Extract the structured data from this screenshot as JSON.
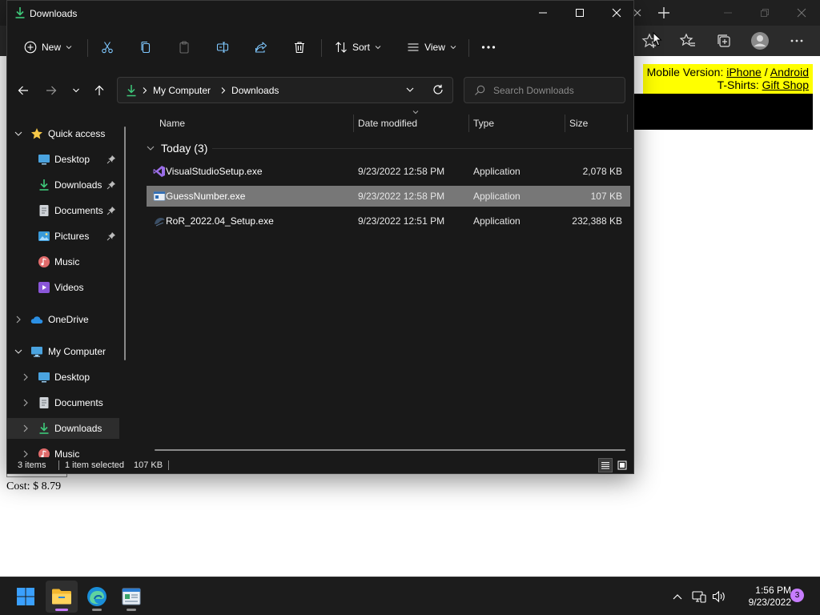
{
  "window": {
    "title": "Downloads"
  },
  "toolbar": {
    "new_label": "New",
    "sort_label": "Sort",
    "view_label": "View"
  },
  "address": {
    "segments": [
      "My Computer",
      "Downloads"
    ]
  },
  "search": {
    "placeholder": "Search Downloads"
  },
  "sidebar": {
    "items": [
      {
        "label": "Quick access",
        "icon": "star-icon"
      },
      {
        "label": "Desktop",
        "icon": "desktop-icon",
        "pinned": true
      },
      {
        "label": "Downloads",
        "icon": "download-icon",
        "pinned": true
      },
      {
        "label": "Documents",
        "icon": "documents-icon",
        "pinned": true
      },
      {
        "label": "Pictures",
        "icon": "pictures-icon",
        "pinned": true
      },
      {
        "label": "Music",
        "icon": "music-icon"
      },
      {
        "label": "Videos",
        "icon": "videos-icon"
      },
      {
        "label": "OneDrive",
        "icon": "cloud-icon"
      },
      {
        "label": "My Computer",
        "icon": "computer-icon"
      },
      {
        "label": "Desktop",
        "icon": "desktop-icon"
      },
      {
        "label": "Documents",
        "icon": "documents-icon"
      },
      {
        "label": "Downloads",
        "icon": "download-icon"
      },
      {
        "label": "Music",
        "icon": "music-icon"
      }
    ]
  },
  "columns": {
    "name": "Name",
    "date": "Date modified",
    "type": "Type",
    "size": "Size"
  },
  "group": {
    "label": "Today (3)"
  },
  "files": [
    {
      "name": "VisualStudioSetup.exe",
      "date": "9/23/2022 12:58 PM",
      "type": "Application",
      "size": "2,078 KB"
    },
    {
      "name": "GuessNumber.exe",
      "date": "9/23/2022 12:58 PM",
      "type": "Application",
      "size": "107 KB"
    },
    {
      "name": "RoR_2022.04_Setup.exe",
      "date": "9/23/2022 12:51 PM",
      "type": "Application",
      "size": "232,388 KB"
    }
  ],
  "status": {
    "items": "3 items",
    "selected": "1 item selected",
    "size": "107 KB"
  },
  "browser_page": {
    "mobile_label": "Mobile Version:",
    "iphone_link": "iPhone",
    "divider": "/",
    "android_link": "Android",
    "tshirts_label": "T-Shirts:",
    "gift_link": "Gift Shop",
    "cost_text": "Cost: $ 8.79"
  },
  "taskbar": {
    "time": "1:56 PM",
    "date": "9/23/2022",
    "notification_count": "3"
  },
  "colors": {
    "accent": "#4cc2ff",
    "selection": "#777777",
    "window_bg": "#191919",
    "promo_bg": "#ffff00",
    "badge": "#c77dff"
  }
}
